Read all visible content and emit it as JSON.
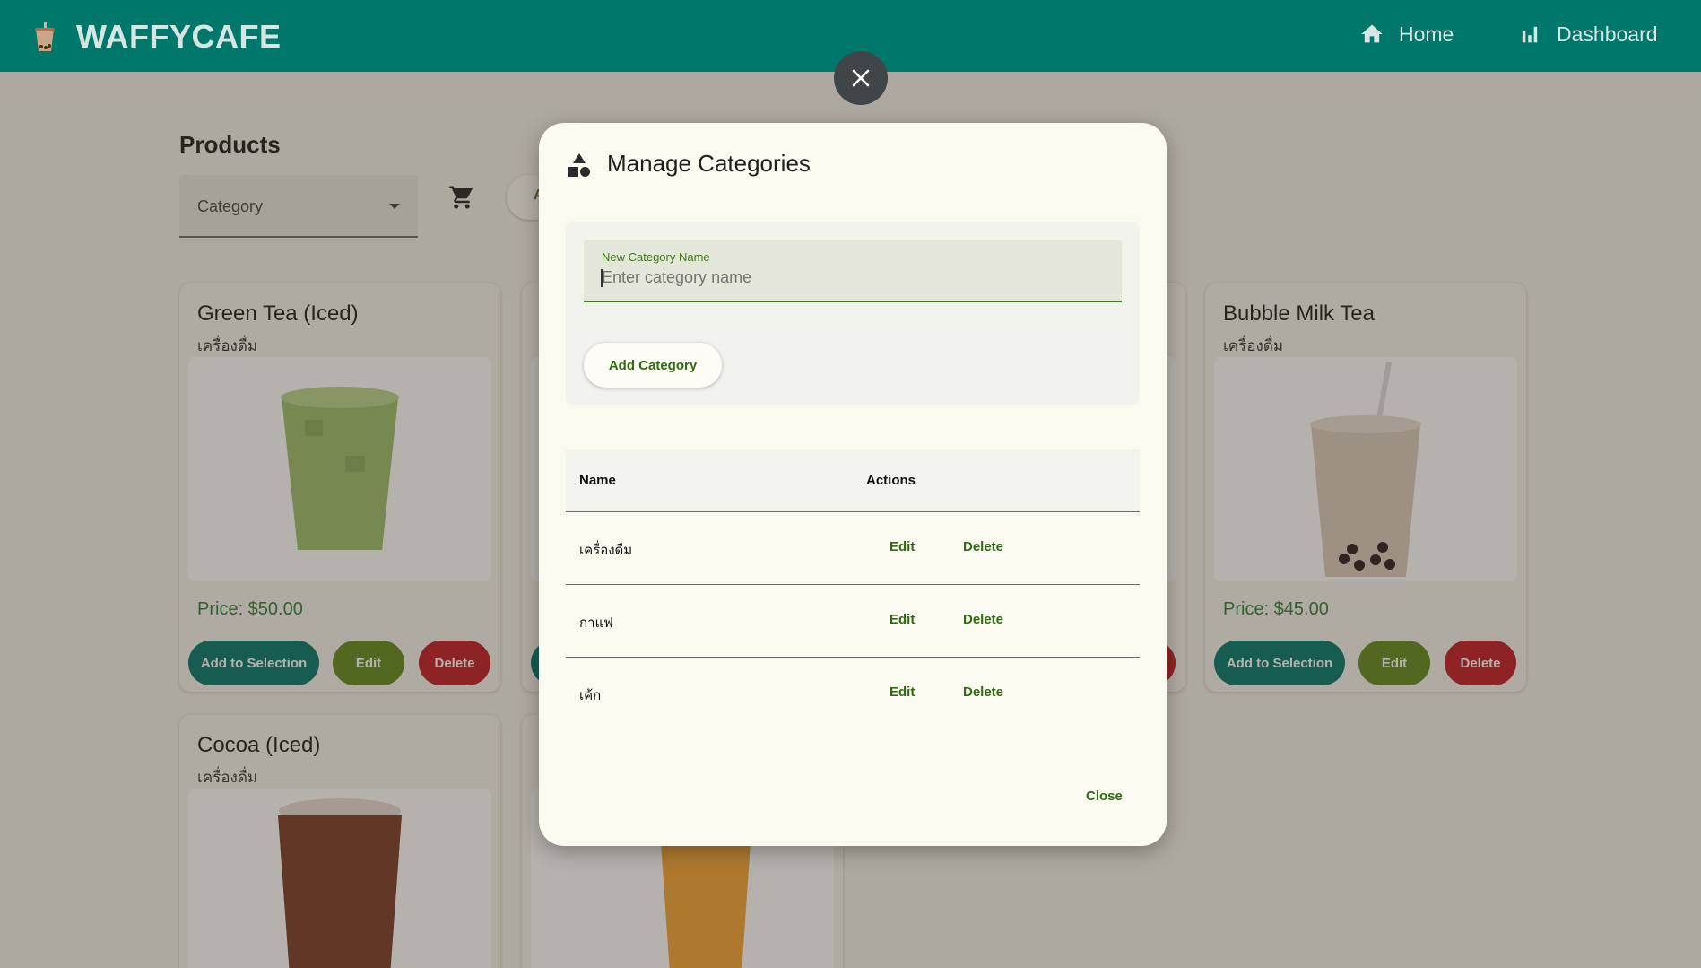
{
  "app": {
    "brand": "WAFFYCAFE"
  },
  "nav": [
    {
      "label": "Home",
      "icon": "home-icon"
    },
    {
      "label": "Dashboard",
      "icon": "bar-chart-icon"
    }
  ],
  "page": {
    "title": "Products",
    "category_select": {
      "label": "Category"
    },
    "pill_stub_text": "A"
  },
  "products": [
    {
      "name": "Green Tea (Iced)",
      "category": "เครื่องดื่ม",
      "price": "Price: $50.00",
      "add_label": "Add to Selection",
      "edit_label": "Edit",
      "delete_label": "Delete",
      "color": "#9bbf6b"
    },
    {
      "name": "Bubble Milk Tea",
      "category": "เครื่องดื่ม",
      "price": "Price: $45.00",
      "add_label": "Add to Selection",
      "edit_label": "Edit",
      "delete_label": "Delete",
      "color": "#d9cbbd"
    },
    {
      "name": "Cocoa (Iced)",
      "category": "เครื่องดื่ม",
      "color": "#7a3a26"
    },
    {
      "color": "#f4a534"
    }
  ],
  "dialog": {
    "title": "Manage Categories",
    "field_label": "New Category Name",
    "field_placeholder": "Enter category name",
    "field_value": "",
    "add_button": "Add Category",
    "table_headers": {
      "name": "Name",
      "actions": "Actions"
    },
    "rows": [
      {
        "name": "เครื่องดื่ม",
        "edit": "Edit",
        "delete": "Delete"
      },
      {
        "name": "กาแฟ",
        "edit": "Edit",
        "delete": "Delete"
      },
      {
        "name": "เค้ก",
        "edit": "Edit",
        "delete": "Delete"
      }
    ],
    "close_label": "Close"
  },
  "colors": {
    "primary": "#00776b",
    "edit_green": "#5f8a1e",
    "delete_red": "#bf1b25",
    "text_green": "#2f6b10"
  }
}
